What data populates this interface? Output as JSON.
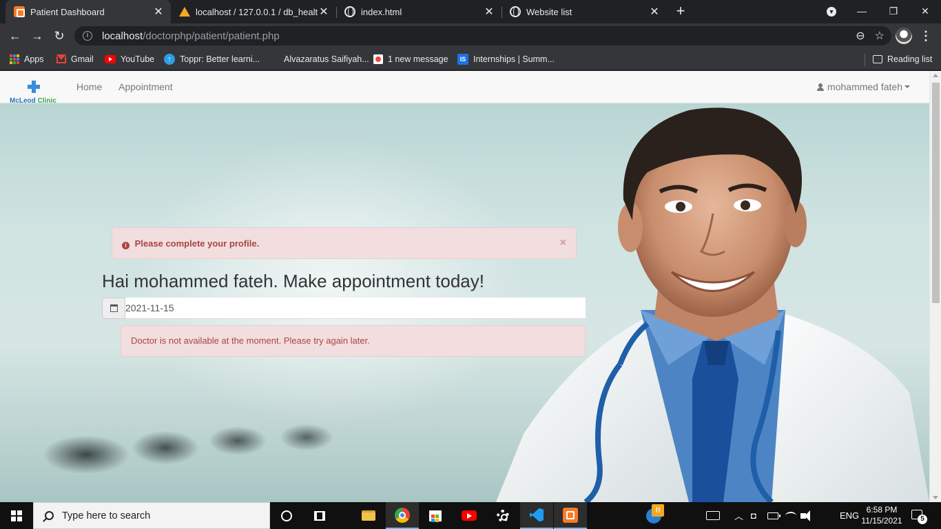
{
  "browser": {
    "tabs": [
      {
        "title": "Patient Dashboard",
        "icon": "xampp-icon",
        "active": true
      },
      {
        "title": "localhost / 127.0.0.1 / db_healthc",
        "icon": "phpmyadmin-icon",
        "active": false
      },
      {
        "title": "index.html",
        "icon": "globe-icon",
        "active": false
      },
      {
        "title": "Website list",
        "icon": "globe-icon",
        "active": false
      }
    ],
    "url_host": "localhost",
    "url_path": "/doctorphp/patient/patient.php",
    "bookmarks": [
      {
        "label": "Apps",
        "icon": "apps-grid-icon"
      },
      {
        "label": "Gmail",
        "icon": "gmail-icon"
      },
      {
        "label": "YouTube",
        "icon": "youtube-icon"
      },
      {
        "label": "Toppr: Better learni...",
        "icon": "toppr-icon"
      },
      {
        "label": "Alvazaratus Saifiyah...",
        "icon": ""
      },
      {
        "label": "1 new message",
        "icon": "message-icon"
      },
      {
        "label": "Internships | Summ...",
        "icon": "internshala-icon"
      }
    ],
    "reading_list": "Reading list"
  },
  "page": {
    "brand": {
      "part1": "McLeod",
      "part2": "Clinic"
    },
    "nav": {
      "home": "Home",
      "appointment": "Appointment"
    },
    "user": "mohammed fateh",
    "profile_alert": "Please complete your profile.",
    "profile_alert_close": "×",
    "greeting": "Hai mohammed fateh. Make appointment today!",
    "date_value": "2021-11-15",
    "doctor_alert": "Doctor is not available at the moment. Please try again later.",
    "colors": {
      "alert_bg": "#f2dede",
      "alert_text": "#a94442",
      "alert_border": "#ebccd1"
    }
  },
  "taskbar": {
    "search_placeholder": "Type here to search",
    "language": "ENG",
    "time": "6:58 PM",
    "date": "11/15/2021",
    "notification_count": "5"
  }
}
